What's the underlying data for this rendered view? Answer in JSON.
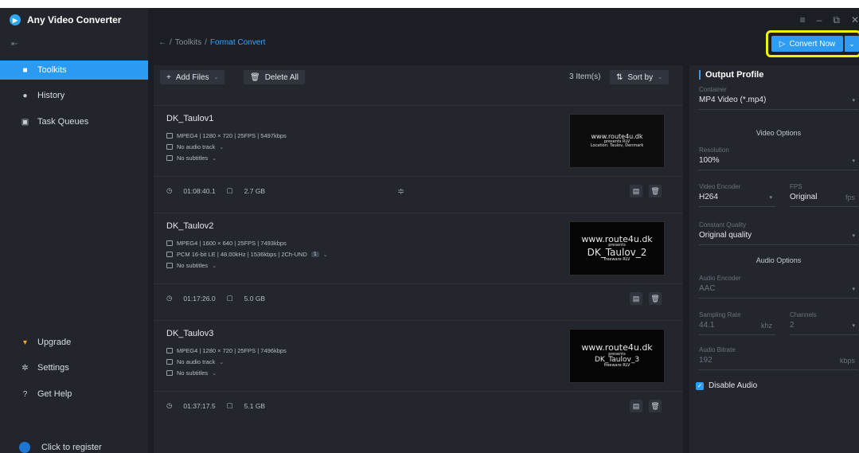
{
  "app": {
    "title": "Any Video Converter"
  },
  "window_controls": {
    "menu": "≡",
    "minimize": "–",
    "restore": "⧉",
    "close": "✕"
  },
  "sidebar": {
    "collapse_icon": "⇤",
    "items": [
      {
        "label": "Toolkits",
        "icon": "toolkits-icon",
        "active": true
      },
      {
        "label": "History",
        "icon": "history-icon",
        "active": false
      },
      {
        "label": "Task Queues",
        "icon": "task-queue-icon",
        "active": false
      },
      {
        "label": "Upgrade",
        "icon": "cart-icon",
        "active": false
      },
      {
        "label": "Settings",
        "icon": "gear-icon",
        "active": false
      },
      {
        "label": "Get Help",
        "icon": "help-icon",
        "active": false
      }
    ],
    "register_label": "Click to register"
  },
  "breadcrumb": {
    "back": "←",
    "sep1": "/",
    "parent": "Toolkits",
    "sep2": "/",
    "current": "Format Convert"
  },
  "convert": {
    "label": "Convert Now",
    "icon": "▷"
  },
  "toolbar": {
    "add_files": "Add Files",
    "delete_all": "Delete All",
    "items_count": "3 Item(s)",
    "sort_by": "Sort by"
  },
  "files": [
    {
      "name": "DK_Taulov1",
      "video": "MPEG4 | 1280 × 720 | 25FPS | 5497kbps",
      "audio": "No audio track",
      "subtitles": "No subtitles",
      "duration": "01:08:40.1",
      "size": "2.7 GB",
      "thumb": {
        "line1": "www.route4u.dk",
        "line2": "presents RLV",
        "line3": "Location: Taulov, Denmark"
      }
    },
    {
      "name": "DK_Taulov2",
      "video": "MPEG4 | 1600 × 640 | 25FPS | 7493kbps",
      "audio": "PCM 16-bit LE | 48.00kHz | 1536kbps | 2Ch-UND",
      "audio_tag": "1",
      "subtitles": "No subtitles",
      "duration": "01:17:26.0",
      "size": "5.0 GB",
      "thumb": {
        "line1": "www.route4u.dk",
        "line2": "presents",
        "line3": "DK_Taulov_2",
        "line4": "freeware RLV"
      }
    },
    {
      "name": "DK_Taulov3",
      "video": "MPEG4 | 1280 × 720 | 25FPS | 7496kbps",
      "audio": "No audio track",
      "subtitles": "No subtitles",
      "duration": "01:37:17.5",
      "size": "5.1 GB",
      "thumb": {
        "line1": "www.route4u.dk",
        "line2": "presents",
        "line3": "DK_Taulov_3",
        "line4": "freeware RLV"
      }
    }
  ],
  "profile": {
    "title": "Output Profile",
    "container_label": "Container",
    "container_value": "MP4 Video (*.mp4)",
    "video_options": "Video Options",
    "resolution_label": "Resolution",
    "resolution_value": "100%",
    "encoder_label": "Video Encoder",
    "encoder_value": "H264",
    "fps_label": "FPS",
    "fps_value": "Original",
    "fps_unit": "fps",
    "quality_label": "Constant Quality",
    "quality_value": "Original quality",
    "audio_options": "Audio Options",
    "audio_encoder_label": "Audio Encoder",
    "audio_encoder_value": "AAC",
    "sampling_label": "Sampling Rate",
    "sampling_value": "44.1",
    "sampling_unit": "khz",
    "channels_label": "Channels",
    "channels_value": "2",
    "bitrate_label": "Audio Bitrate",
    "bitrate_value": "192",
    "bitrate_unit": "kbps",
    "disable_audio": "Disable Audio",
    "disable_audio_checked": true
  },
  "colors": {
    "accent": "#2f9cf4",
    "highlight": "#f1f10b",
    "bg": "#1b1e25",
    "panel": "#23262d"
  }
}
